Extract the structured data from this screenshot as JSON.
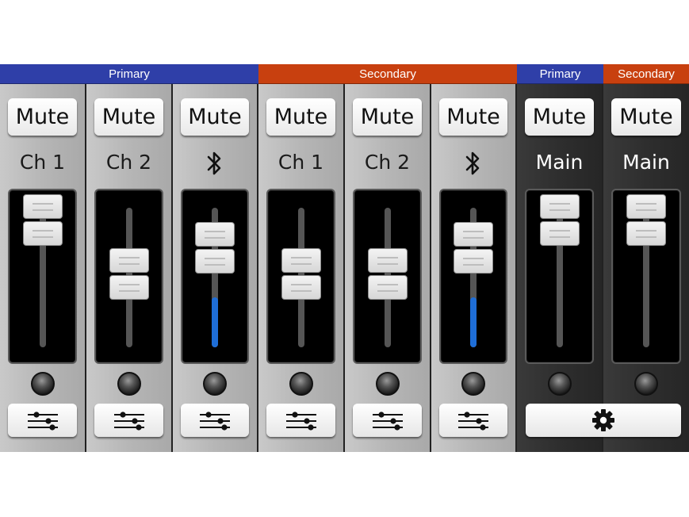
{
  "groups": [
    {
      "label": "Primary",
      "color": "#2f3fa8"
    },
    {
      "label": "Secondary",
      "color": "#c8400f"
    },
    {
      "label": "Primary",
      "color": "#2f3fa8"
    },
    {
      "label": "Secondary",
      "color": "#c8400f"
    }
  ],
  "strips": [
    {
      "id": "primary-ch1",
      "mute_label": "Mute",
      "channel_label": "Ch 1",
      "icon": "",
      "fader_level": 0.91,
      "fill_level": 0,
      "theme": "gray",
      "settings_icon": "sliders-icon"
    },
    {
      "id": "primary-ch2",
      "mute_label": "Mute",
      "channel_label": "Ch 2",
      "icon": "",
      "fader_level": 0.52,
      "fill_level": 0,
      "theme": "gray",
      "settings_icon": "sliders-icon"
    },
    {
      "id": "primary-bluetooth",
      "mute_label": "Mute",
      "channel_label": "",
      "icon": "bluetooth-icon",
      "fader_level": 0.71,
      "fill_level": 0.36,
      "theme": "gray",
      "settings_icon": "sliders-icon"
    },
    {
      "id": "secondary-ch1",
      "mute_label": "Mute",
      "channel_label": "Ch 1",
      "icon": "",
      "fader_level": 0.52,
      "fill_level": 0,
      "theme": "gray",
      "settings_icon": "sliders-icon"
    },
    {
      "id": "secondary-ch2",
      "mute_label": "Mute",
      "channel_label": "Ch 2",
      "icon": "",
      "fader_level": 0.52,
      "fill_level": 0,
      "theme": "gray",
      "settings_icon": "sliders-icon"
    },
    {
      "id": "secondary-bluetooth",
      "mute_label": "Mute",
      "channel_label": "",
      "icon": "bluetooth-icon",
      "fader_level": 0.71,
      "fill_level": 0.36,
      "theme": "gray",
      "settings_icon": "sliders-icon"
    },
    {
      "id": "primary-main",
      "mute_label": "Mute",
      "channel_label": "Main",
      "icon": "",
      "fader_level": 0.91,
      "fill_level": 0,
      "theme": "dark",
      "settings_icon": ""
    },
    {
      "id": "secondary-main",
      "mute_label": "Mute",
      "channel_label": "Main",
      "icon": "",
      "fader_level": 0.91,
      "fill_level": 0,
      "theme": "dark",
      "settings_icon": ""
    }
  ],
  "global_settings_icon": "gear-icon",
  "colors": {
    "accent_fill": "#1e6ed8",
    "primary": "#2f3fa8",
    "secondary": "#c8400f"
  }
}
